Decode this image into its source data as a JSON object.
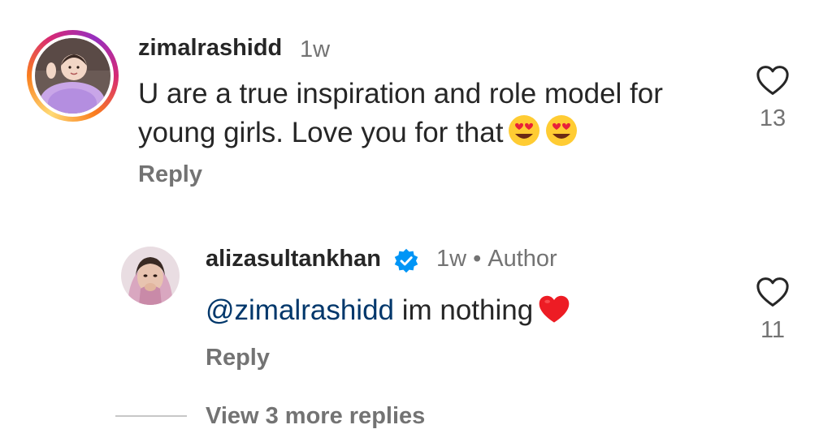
{
  "comment": {
    "username": "zimalrashidd",
    "time": "1w",
    "text": "U are a true inspiration and role model for young girls. Love you for that",
    "emojis": [
      "heart-eyes",
      "heart-eyes"
    ],
    "reply_label": "Reply",
    "like_count": "13"
  },
  "reply": {
    "username": "alizasultankhan",
    "verified": true,
    "time": "1w",
    "separator": "•",
    "author_badge": "Author",
    "mention": "@zimalrashidd",
    "text": " im nothing",
    "emoji": "red-heart",
    "reply_label": "Reply",
    "like_count": "11"
  },
  "view_more_label": "View 3 more replies",
  "colors": {
    "text_primary": "#262626",
    "text_secondary": "#737373",
    "mention": "#00376b",
    "verified": "#0095f6",
    "heart": "#ed1c24"
  }
}
